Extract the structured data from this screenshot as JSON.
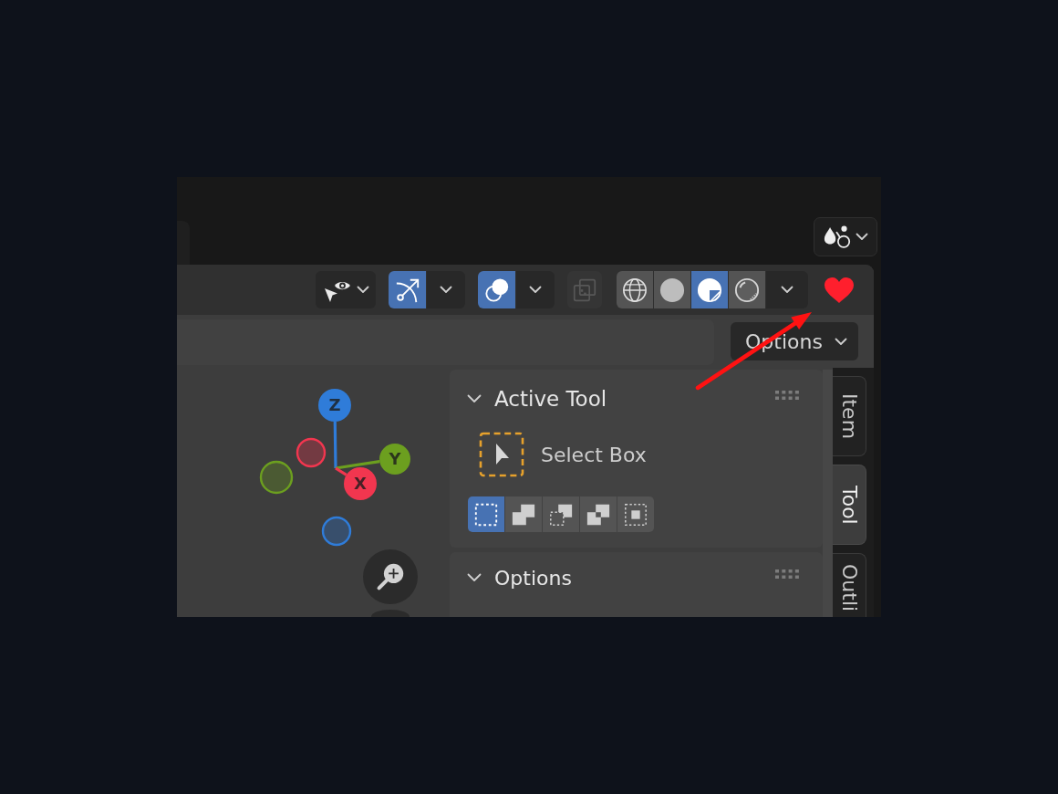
{
  "header": {
    "toggles": [
      {
        "kind": "gizmo",
        "on": true
      },
      {
        "kind": "overlays",
        "on": true
      }
    ],
    "xray": {
      "disabled": true
    },
    "shading_modes": [
      {
        "kind": "wireframe",
        "selected": false
      },
      {
        "kind": "solid",
        "selected": false
      },
      {
        "kind": "material",
        "selected": true
      },
      {
        "kind": "rendered",
        "selected": false
      }
    ]
  },
  "tool_header": {
    "options_menu": {
      "label": "Options"
    }
  },
  "gizmo": {
    "axes": [
      {
        "label": "Z",
        "color": "#2f7cd9"
      },
      {
        "label": "Y",
        "color": "#6c9f1f"
      },
      {
        "label": "X",
        "color": "#f2364f"
      }
    ]
  },
  "sidebar": {
    "panels": [
      {
        "title": "Active Tool",
        "expanded": true,
        "tool": {
          "name": "Select Box"
        },
        "modes": [
          {
            "kind": "set",
            "selected": true
          },
          {
            "kind": "extend",
            "selected": false
          },
          {
            "kind": "subtract",
            "selected": false
          },
          {
            "kind": "invert",
            "selected": false
          },
          {
            "kind": "intersect",
            "selected": false
          }
        ]
      },
      {
        "title": "Options",
        "expanded": true
      }
    ],
    "tabs": [
      {
        "label": "Item",
        "selected": false
      },
      {
        "label": "Tool",
        "selected": true
      },
      {
        "label": "Outli",
        "selected": false
      }
    ]
  }
}
